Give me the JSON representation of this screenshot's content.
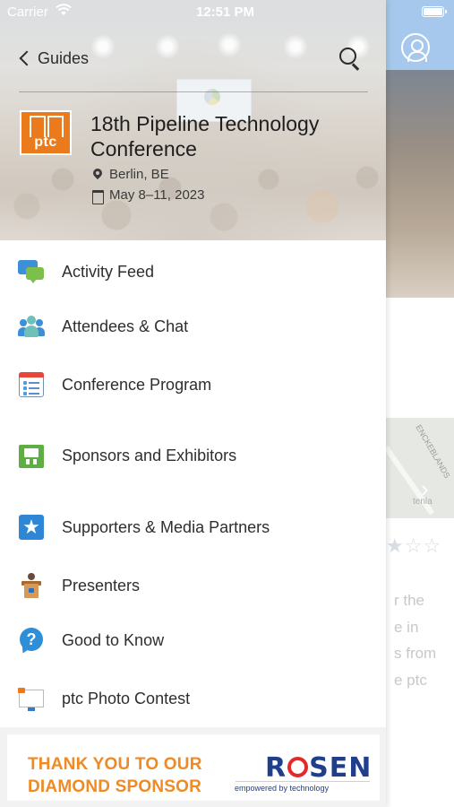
{
  "status_bar": {
    "carrier": "Carrier",
    "time": "12:51 PM"
  },
  "header": {
    "back_label": "Guides",
    "event_title": "18th Pipeline Technology Conference",
    "logo_text": "ptc",
    "location": "Berlin, BE",
    "dates": "May 8–11, 2023"
  },
  "menu": [
    {
      "label": "Activity Feed",
      "icon": "activity-feed-icon"
    },
    {
      "label": "Attendees & Chat",
      "icon": "attendees-icon"
    },
    {
      "label": "Conference Program",
      "icon": "calendar-checklist-icon"
    },
    {
      "label": "Sponsors and Exhibitors",
      "icon": "exhibitor-booth-icon"
    },
    {
      "label": "Supporters & Media Partners",
      "icon": "star-badge-icon"
    },
    {
      "label": "Presenters",
      "icon": "podium-icon"
    },
    {
      "label": "Good to Know",
      "icon": "question-bubble-icon"
    },
    {
      "label": "ptc Photo Contest",
      "icon": "photo-contest-icon"
    }
  ],
  "sponsor_banner": {
    "line1": "THANK YOU TO OUR",
    "line2": "DIAMOND SPONSOR",
    "brand_prefix": "R",
    "brand_suffix": "SEN",
    "tagline": "empowered by technology"
  },
  "background_app": {
    "map_label": "ENCKEBLANDS",
    "map_label_2": "tenla",
    "text_lines": [
      "r the",
      "e in",
      "s from",
      "e ptc"
    ]
  },
  "colors": {
    "accent_orange": "#ea7a1c",
    "sponsor_blue": "#1f3f8a",
    "sponsor_red": "#e12a2a",
    "header_blue": "#a6c8ec"
  }
}
